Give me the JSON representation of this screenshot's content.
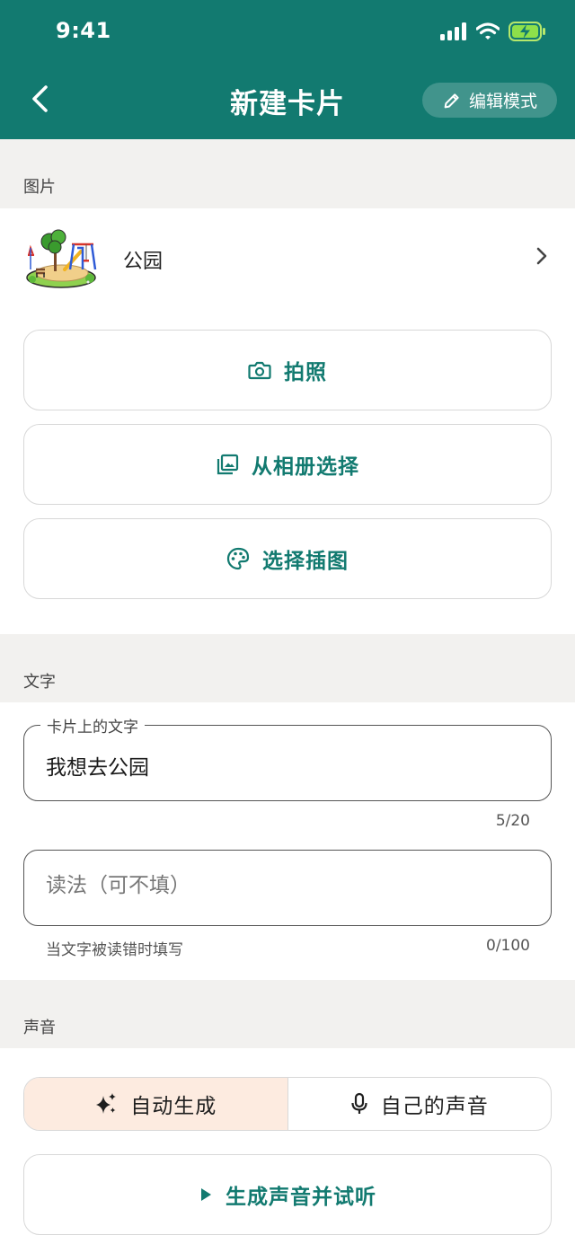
{
  "status_bar": {
    "time": "9:41"
  },
  "nav": {
    "title": "新建卡片",
    "edit_mode_label": "编辑模式"
  },
  "sections": {
    "image": "图片",
    "text": "文字",
    "sound": "声音"
  },
  "image_row": {
    "name": "公园"
  },
  "image_options": {
    "take_photo": "拍照",
    "choose_album": "从相册选择",
    "choose_illustration": "选择插图"
  },
  "text_section": {
    "card_text": {
      "label": "卡片上的文字",
      "value": "我想去公园",
      "counter": "5/20"
    },
    "pronunciation": {
      "placeholder": "读法（可不填）",
      "helper": "当文字被读错时填写",
      "counter": "0/100"
    }
  },
  "sound_section": {
    "auto_generate": "自动生成",
    "own_voice": "自己的声音",
    "generate_preview": "生成声音并试听"
  },
  "colors": {
    "primary": "#127a70",
    "section_bg": "#f2f1ef",
    "segment_active": "#fdebe0"
  }
}
